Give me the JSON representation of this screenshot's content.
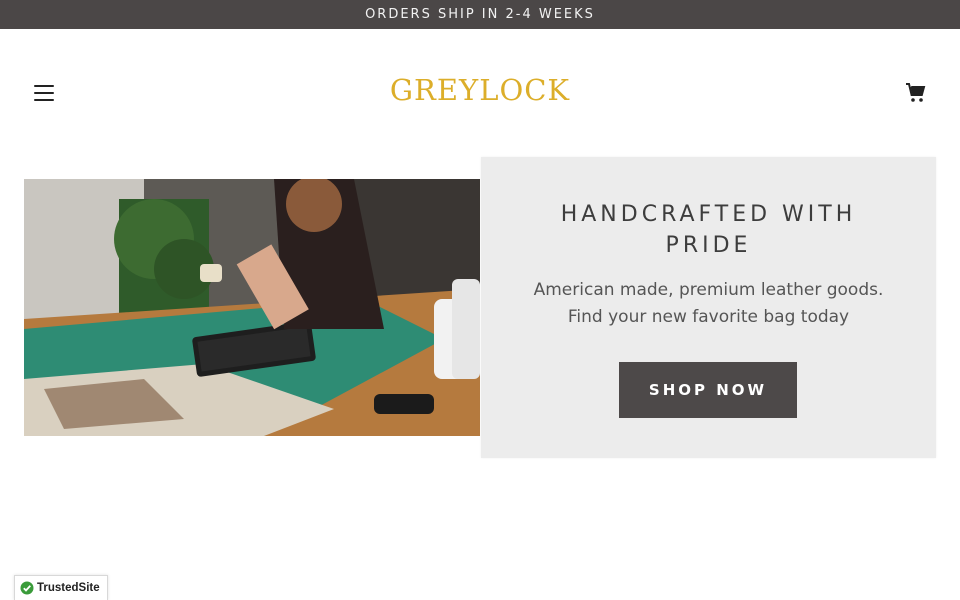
{
  "announcement": {
    "text": "ORDERS SHIP IN 2-4 WEEKS"
  },
  "header": {
    "logo": "GREYLOCK",
    "menu_icon": "hamburger-icon",
    "cart_icon": "cart-icon"
  },
  "hero": {
    "image_icon": "leather-workshop-photo",
    "title": "HANDCRAFTED WITH PRIDE",
    "subtitle_line1": "American made, premium leather goods.",
    "subtitle_line2": "Find your new favorite bag today",
    "cta_label": "SHOP NOW"
  },
  "badge": {
    "label": "TrustedSite",
    "icon": "check-shield-icon"
  },
  "colors": {
    "announcement_bg": "#4b4747",
    "logo": "#dcae2a",
    "card_bg": "#ececec",
    "button_bg": "#4d4949"
  }
}
